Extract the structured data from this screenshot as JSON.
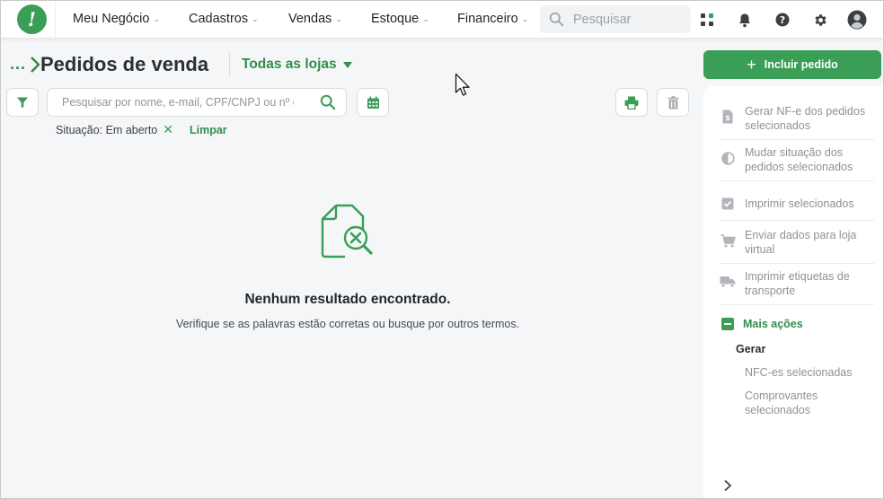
{
  "nav": {
    "items": [
      {
        "label": "Meu Negócio"
      },
      {
        "label": "Cadastros"
      },
      {
        "label": "Vendas"
      },
      {
        "label": "Estoque"
      },
      {
        "label": "Financeiro"
      }
    ],
    "search_placeholder": "Pesquisar",
    "icons": [
      "apps-icon",
      "bell-icon",
      "help-icon",
      "gear-icon",
      "user-avatar-icon"
    ]
  },
  "header": {
    "breadcrumb_dots": "...",
    "title": "Pedidos de venda",
    "store_select": "Todas as lojas",
    "include_button": "Incluir pedido"
  },
  "toolbar": {
    "search_placeholder": "Pesquisar por nome, e-mail, CPF/CNPJ ou nº do pedido"
  },
  "filters": {
    "situation": "Situação: Em aberto",
    "clear": "Limpar"
  },
  "empty": {
    "title": "Nenhum resultado encontrado.",
    "subtitle": "Verifique se as palavras estão corretas ou busque por outros termos."
  },
  "sidebar": {
    "actions": [
      {
        "label": "Gerar NF-e dos pedidos selecionados",
        "icon": "document-dollar-icon"
      },
      {
        "label": "Mudar situação dos pedidos selecionados",
        "icon": "half-circle-icon"
      },
      {
        "label": "Imprimir selecionados",
        "icon": "checkbox-icon"
      },
      {
        "label": "Enviar dados para loja virtual",
        "icon": "cart-icon"
      },
      {
        "label": "Imprimir etiquetas de transporte",
        "icon": "truck-icon"
      }
    ],
    "more_actions": "Mais ações",
    "generate_heading": "Gerar",
    "generate_items": [
      {
        "label": "NFC-es selecionadas"
      },
      {
        "label": "Comprovantes selecionados"
      }
    ]
  },
  "colors": {
    "brand": "#3a9e56",
    "brand_text": "#2f8f4b",
    "background": "#f5f6f8"
  }
}
